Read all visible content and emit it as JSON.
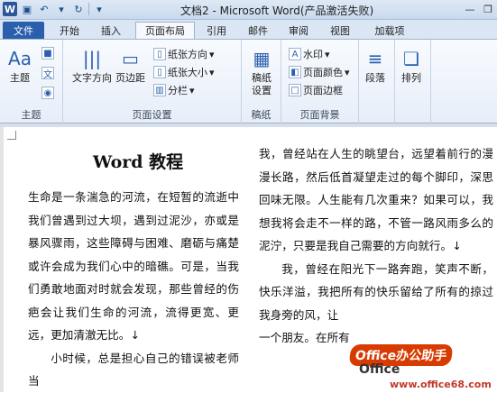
{
  "window": {
    "title": "文档2 - Microsoft Word(产品激活失败)"
  },
  "tabs": [
    "文件",
    "开始",
    "插入",
    "页面布局",
    "引用",
    "邮件",
    "审阅",
    "视图",
    "加载项"
  ],
  "ribbon": {
    "theme_group": {
      "theme": "主题",
      "label": "主题"
    },
    "page_setup": {
      "text_direction": "文字方向",
      "margins": "页边距",
      "orientation": "纸张方向",
      "size": "纸张大小",
      "columns": "分栏",
      "label": "页面设置"
    },
    "manuscript": {
      "settings": "稿纸\n设置",
      "label": "稿纸"
    },
    "background": {
      "watermark": "水印",
      "page_color": "页面颜色",
      "page_border": "页面边框",
      "label": "页面背景"
    },
    "paragraph": {
      "label": "段落"
    },
    "arrange": {
      "label": "排列"
    }
  },
  "document": {
    "title": "Word 教程",
    "col1": "生命是一条湍急的河流，在短暂的流逝中我们曾遇到过大坝，遇到过泥沙，亦或是暴风骤雨，这些障碍与困难、磨砺与痛楚或许会成为我们心中的暗礁。可是，当我们勇敢地面对时就会发现，那些曾经的伤疤会让我们生命的河流，流得更宽、更远，更加清澈无比。↓",
    "col1b": "小时候，总是担心自己的错误被老师当",
    "col2a": "我，曾经站在人生的眺望台，远望着前行的漫漫长路，然后低首凝望走过的每个脚印，深思回味无限。人生能有几次重来？如果可以，我想我将会走不一样的路，不管一路风雨多么的泥泞，只要是我自己需要的方向就行。↓",
    "col2b": "我，曾经在阳光下一路奔跑，笑声不断，快乐洋溢，我把所有的快乐留给了所有的掠过我身旁的风，让",
    "col2c": "一个朋友。在所有"
  },
  "watermark": {
    "badge": "Office办公助手",
    "main": "Office",
    "site": "www.office68.com"
  }
}
